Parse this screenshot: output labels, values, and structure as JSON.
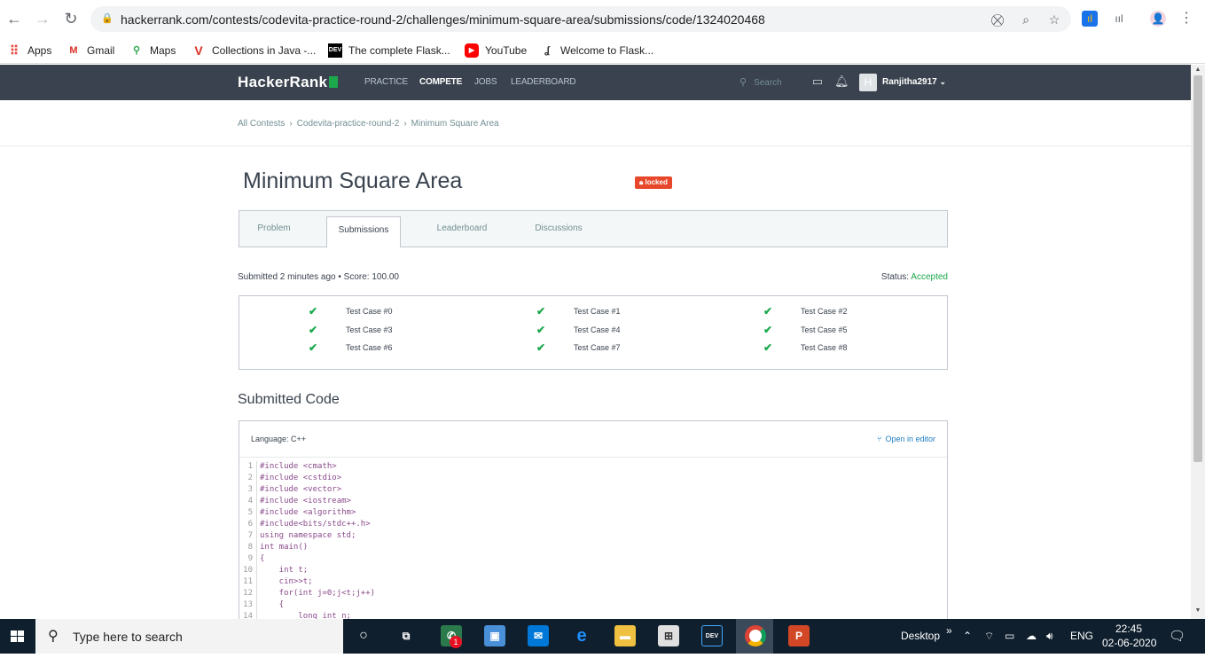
{
  "browser": {
    "url": "hackerrank.com/contests/codevita-practice-round-2/challenges/minimum-square-area/submissions/code/1324020468",
    "bookmarks": [
      {
        "label": "Apps",
        "icon": "apps-grid-icon"
      },
      {
        "label": "Gmail",
        "icon": "gmail-icon"
      },
      {
        "label": "Maps",
        "icon": "maps-icon"
      },
      {
        "label": "Collections in Java -...",
        "icon": "v-logo-icon"
      },
      {
        "label": "The complete Flask...",
        "icon": "dev-icon"
      },
      {
        "label": "YouTube",
        "icon": "youtube-icon"
      },
      {
        "label": "Welcome to Flask...",
        "icon": "flask-icon"
      }
    ]
  },
  "header": {
    "logo": "HackerRank",
    "nav": [
      "PRACTICE",
      "COMPETE",
      "JOBS",
      "LEADERBOARD"
    ],
    "active_nav": "COMPETE",
    "search_placeholder": "Search",
    "avatar_letter": "H",
    "username": "Ranjitha2917"
  },
  "breadcrumb": [
    "All Contests",
    "Codevita-practice-round-2",
    "Minimum Square Area"
  ],
  "challenge": {
    "title": "Minimum Square Area",
    "badge": "locked"
  },
  "tabs": [
    "Problem",
    "Submissions",
    "Leaderboard",
    "Discussions"
  ],
  "active_tab": "Submissions",
  "submission": {
    "info": "Submitted 2 minutes ago • Score: 100.00",
    "status_label": "Status:",
    "status_value": "Accepted"
  },
  "test_cases": [
    "Test Case #0",
    "Test Case #1",
    "Test Case #2",
    "Test Case #3",
    "Test Case #4",
    "Test Case #5",
    "Test Case #6",
    "Test Case #7",
    "Test Case #8"
  ],
  "code_section": {
    "heading": "Submitted Code",
    "language": "Language: C++",
    "open_editor": "Open in editor",
    "lines": [
      "#include <cmath>",
      "#include <cstdio>",
      "#include <vector>",
      "#include <iostream>",
      "#include <algorithm>",
      "#include<bits/stdc++.h>",
      "using namespace std;",
      "int main()",
      "{",
      "    int t;",
      "    cin>>t;",
      "    for(int j=0;j<t;j++)",
      "    {",
      "        long int n;"
    ]
  },
  "taskbar": {
    "search_placeholder": "Type here to search",
    "desktop_label": "Desktop",
    "language": "ENG",
    "time": "22:45",
    "date": "02-06-2020",
    "notification_count": "1"
  },
  "colors": {
    "header_bg": "#39424e",
    "accent_green": "#1ba94c",
    "locked_red": "#e7472b",
    "link_blue": "#1f7ec1"
  }
}
